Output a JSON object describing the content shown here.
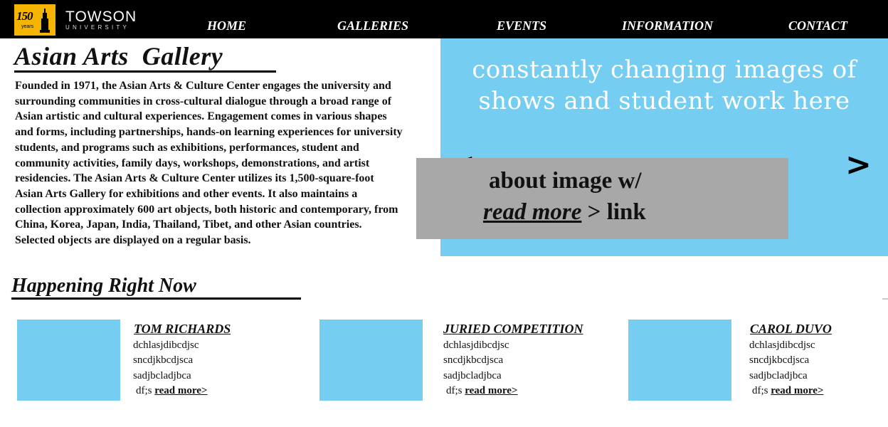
{
  "logo": {
    "anniversary": "150",
    "anniversary_sub": "years",
    "name": "TOWSON",
    "sub": "UNIVERSITY"
  },
  "nav": [
    "HOME",
    "GALLERIES",
    "EVENTS",
    "INFORMATION",
    "CONTACT"
  ],
  "page": {
    "title": "Asian Arts  Gallery",
    "about": "Founded in 1971, the Asian Arts & Culture Center engages the university and surrounding communities in cross-cultural dialogue through a broad range of Asian artistic and cultural experiences. Engagement comes in various shapes and forms, including partnerships, hands-on learning experiences for university students, and programs such as exhibitions, performances, student and community activities, family days, workshops, demonstrations, and artist residencies. The Asian Arts & Culture Center utilizes its 1,500-square-foot Asian Arts Gallery for exhibitions and other events. It also maintains a collection approximately 600 art objects, both historic and contemporary, from China, Korea, Japan, India, Thailand, Tibet, and other Asian countries. Selected objects are displayed on a regular basis."
  },
  "slider": {
    "text_line1": "constantly changing images of",
    "text_line2": "shows and student work here",
    "prev": "<",
    "next": ">",
    "caption_line1": "about image w/",
    "caption_read_more": "read more",
    "caption_link_suffix": " > link"
  },
  "happening": {
    "title": "Happening Right Now",
    "cards": [
      {
        "title": "TOM RICHARDS",
        "lines": [
          "dchlasjdibcdjsc",
          "sncdjkbcdjsca",
          "sadjbcladjbca"
        ],
        "prefix": "df;s",
        "more": "read more>"
      },
      {
        "title": "JURIED COMPETITION",
        "lines": [
          "dchlasjdibcdjsc",
          "sncdjkbcdjsca",
          "sadjbcladjbca"
        ],
        "prefix": "df;s",
        "more": "read more>"
      },
      {
        "title": "CAROL DUVO",
        "lines": [
          "dchlasjdibcdjsc",
          "sncdjkbcdjsca",
          "sadjbcladjbca"
        ],
        "prefix": "df;s",
        "more": "read more>"
      }
    ]
  },
  "colors": {
    "accent_blue": "#75cdf2",
    "caption_gray": "#a8a8a8",
    "logo_gold": "#f5b400",
    "header_black": "#000000"
  }
}
